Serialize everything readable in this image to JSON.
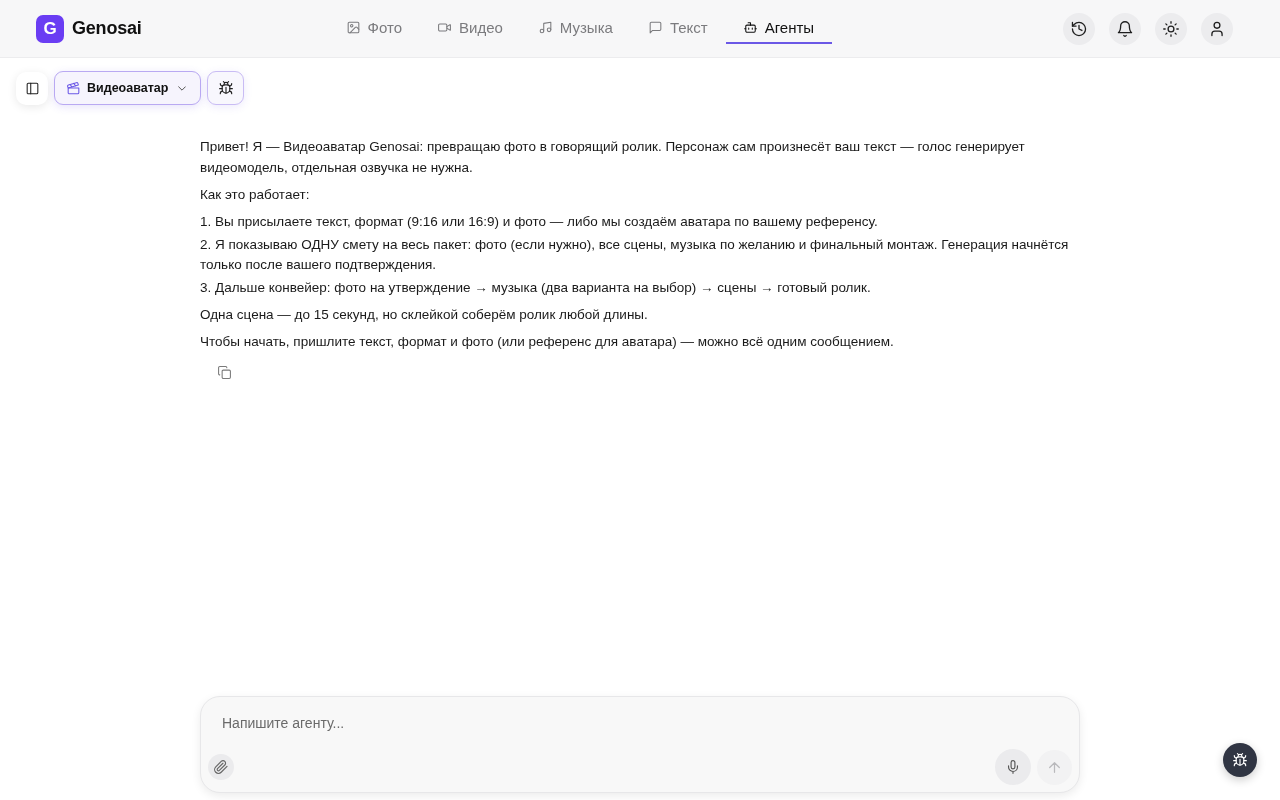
{
  "header": {
    "logo": {
      "mark": "G",
      "name": "Genosai"
    },
    "tabs": [
      {
        "kind": "image",
        "label": "Фото",
        "selected": false
      },
      {
        "kind": "video",
        "label": "Видео",
        "selected": false
      },
      {
        "kind": "music",
        "label": "Музыка",
        "selected": false
      },
      {
        "kind": "chat",
        "label": "Текст",
        "selected": false
      },
      {
        "kind": "robot",
        "label": "Агенты",
        "selected": true
      }
    ],
    "actions": [
      {
        "kind": "history"
      },
      {
        "kind": "bell"
      },
      {
        "kind": "sun"
      },
      {
        "kind": "user"
      }
    ]
  },
  "toolbar": {
    "agent_select": {
      "label": "Видеоаватар"
    }
  },
  "message": {
    "blocks": [
      {
        "kind": "paragraph",
        "text": "Привет! Я — Видеоаватар Genosai: превращаю фото в говорящий ролик. Персонаж сам произнесёт ваш текст — голос генерирует видеомодель, отдельная озвучка не нужна."
      },
      {
        "kind": "paragraph",
        "text": "Как это работает:"
      },
      {
        "kind": "list_item",
        "text": "1. Вы присылаете текст, формат (9:16 или 16:9) и фото — либо мы создаём аватара по вашему референсу."
      },
      {
        "kind": "list_item",
        "text": "2. Я показываю ОДНУ смету на весь пакет: фото (если нужно), все сцены, музыка по желанию и финальный монтаж. Генерация начнётся только после вашего подтверждения."
      },
      {
        "kind": "list_item",
        "text": "3. Дальше конвейер: фото на утверждение → музыка (два варианта на выбор) → сцены → готовый ролик."
      },
      {
        "kind": "paragraph",
        "text": "Одна сцена — до 15 секунд, но склейкой соберём ролик любой длины."
      },
      {
        "kind": "paragraph",
        "text": "Чтобы начать, пришлите текст, формат и фото (или референс для аватара) — можно всё одним сообщением."
      }
    ]
  },
  "composer": {
    "placeholder": "Напишите агенту..."
  }
}
